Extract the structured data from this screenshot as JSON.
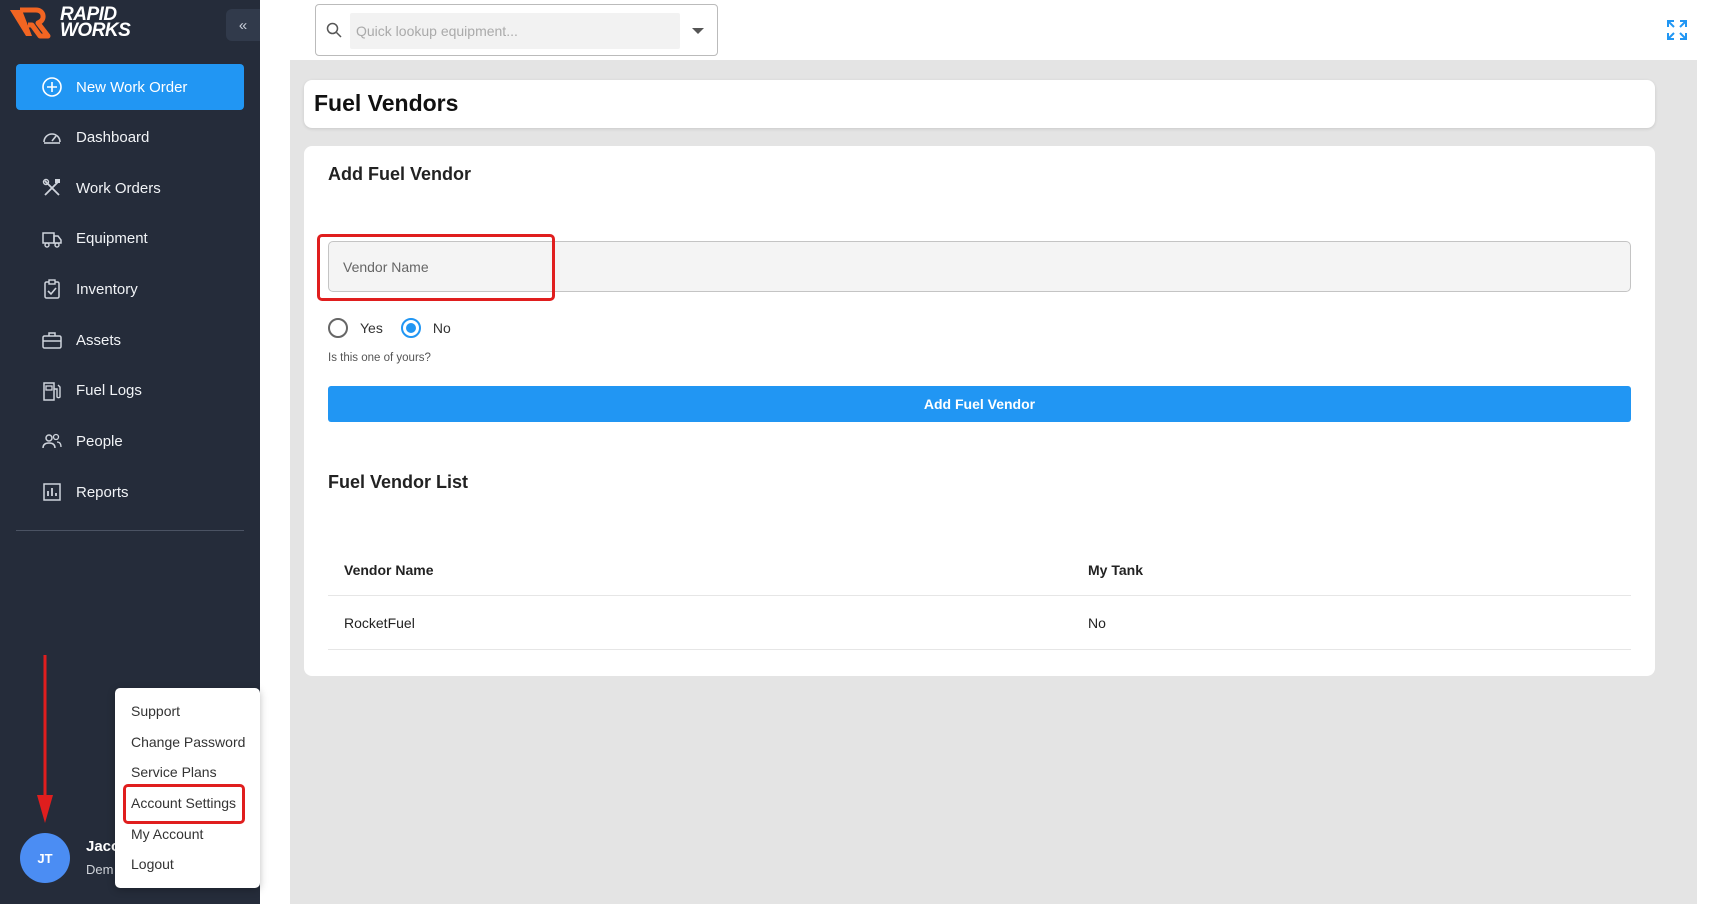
{
  "app": {
    "brand_line1": "RAPID",
    "brand_line2": "WORKS",
    "collapse_label": "«"
  },
  "sidebar": {
    "new_work_order": "New Work Order",
    "items": [
      {
        "label": "Dashboard",
        "icon": "speedometer-icon"
      },
      {
        "label": "Work Orders",
        "icon": "tools-icon"
      },
      {
        "label": "Equipment",
        "icon": "truck-icon"
      },
      {
        "label": "Inventory",
        "icon": "clipboard-check-icon"
      },
      {
        "label": "Assets",
        "icon": "toolbox-icon"
      },
      {
        "label": "Fuel Logs",
        "icon": "fuel-pump-icon"
      },
      {
        "label": "People",
        "icon": "people-icon"
      },
      {
        "label": "Reports",
        "icon": "bar-chart-icon"
      }
    ]
  },
  "user": {
    "initials": "JT",
    "name": "Jaco",
    "subtitle": "Dem"
  },
  "user_menu": {
    "items": [
      "Support",
      "Change Password",
      "Service Plans",
      "Account Settings",
      "My Account",
      "Logout"
    ]
  },
  "search": {
    "placeholder": "Quick lookup equipment..."
  },
  "page": {
    "title": "Fuel Vendors"
  },
  "form": {
    "title": "Add Fuel Vendor",
    "vendor_placeholder": "Vendor Name",
    "yes_label": "Yes",
    "no_label": "No",
    "selected": "No",
    "hint": "Is this one of yours?",
    "submit_label": "Add Fuel Vendor"
  },
  "list": {
    "title": "Fuel Vendor List",
    "columns": [
      "Vendor Name",
      "My Tank"
    ],
    "rows": [
      [
        "RocketFuel",
        "No"
      ]
    ]
  },
  "colors": {
    "sidebar_bg": "#252c3a",
    "accent": "#2196f3",
    "highlight": "#e01e1e"
  }
}
